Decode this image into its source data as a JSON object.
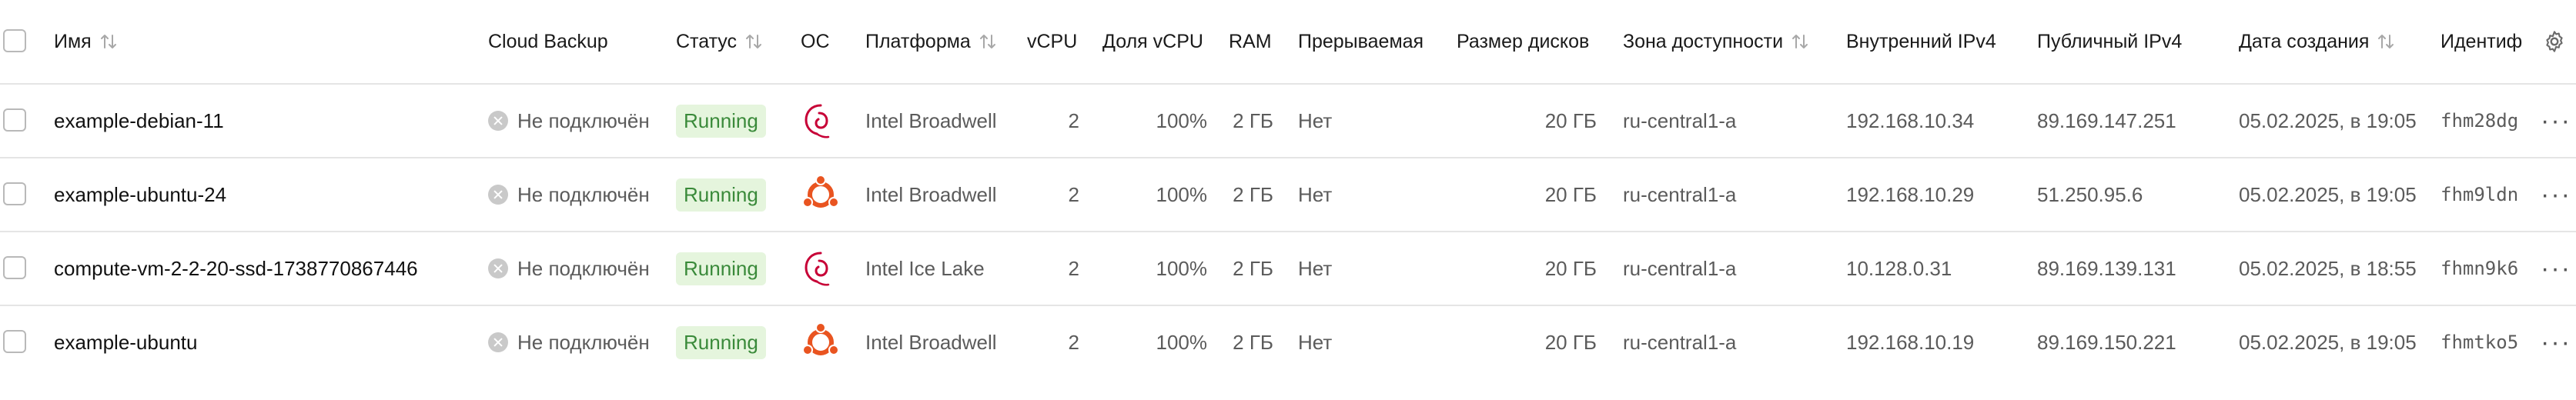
{
  "columns": {
    "name": "Имя",
    "backup": "Cloud Backup",
    "status": "Статус",
    "os": "ОС",
    "platform": "Платформа",
    "vcpu": "vCPU",
    "vcpu_share": "Доля vCPU",
    "ram": "RAM",
    "preemptible": "Прерываемая",
    "disk": "Размер дисков",
    "zone": "Зона доступности",
    "ip_internal": "Внутренний IPv4",
    "ip_public": "Публичный IPv4",
    "created": "Дата создания",
    "id": "Идентиф"
  },
  "icons": {
    "sort": "sort-arrows-icon",
    "settings": "gear-icon",
    "debian": "debian-logo-icon",
    "ubuntu": "ubuntu-logo-icon",
    "backup_off": "close-circle-icon",
    "more": "more-horizontal-icon"
  },
  "colors": {
    "status_bg": "#e5f5dd",
    "status_text": "#3a8a3a",
    "debian": "#c70036",
    "ubuntu": "#e95420"
  },
  "rows": [
    {
      "name": "example-debian-11",
      "backup": "Не подключён",
      "status": "Running",
      "os": "debian",
      "platform": "Intel Broadwell",
      "vcpu": "2",
      "vcpu_share": "100%",
      "ram": "2 ГБ",
      "preemptible": "Нет",
      "disk": "20 ГБ",
      "zone": "ru-central1-a",
      "ip_internal": "192.168.10.34",
      "ip_public": "89.169.147.251",
      "created": "05.02.2025, в 19:05",
      "id": "fhm28dg"
    },
    {
      "name": "example-ubuntu-24",
      "backup": "Не подключён",
      "status": "Running",
      "os": "ubuntu",
      "platform": "Intel Broadwell",
      "vcpu": "2",
      "vcpu_share": "100%",
      "ram": "2 ГБ",
      "preemptible": "Нет",
      "disk": "20 ГБ",
      "zone": "ru-central1-a",
      "ip_internal": "192.168.10.29",
      "ip_public": "51.250.95.6",
      "created": "05.02.2025, в 19:05",
      "id": "fhm9ldn"
    },
    {
      "name": "compute-vm-2-2-20-ssd-1738770867446",
      "backup": "Не подключён",
      "status": "Running",
      "os": "debian",
      "platform": "Intel Ice Lake",
      "vcpu": "2",
      "vcpu_share": "100%",
      "ram": "2 ГБ",
      "preemptible": "Нет",
      "disk": "20 ГБ",
      "zone": "ru-central1-a",
      "ip_internal": "10.128.0.31",
      "ip_public": "89.169.139.131",
      "created": "05.02.2025, в 18:55",
      "id": "fhmn9k6"
    },
    {
      "name": "example-ubuntu",
      "backup": "Не подключён",
      "status": "Running",
      "os": "ubuntu",
      "platform": "Intel Broadwell",
      "vcpu": "2",
      "vcpu_share": "100%",
      "ram": "2 ГБ",
      "preemptible": "Нет",
      "disk": "20 ГБ",
      "zone": "ru-central1-a",
      "ip_internal": "192.168.10.19",
      "ip_public": "89.169.150.221",
      "created": "05.02.2025, в 19:05",
      "id": "fhmtko5"
    }
  ]
}
